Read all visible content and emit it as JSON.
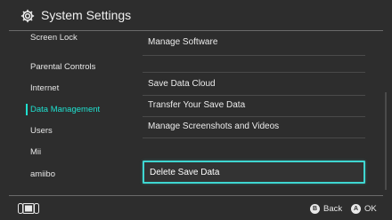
{
  "header": {
    "title": "System Settings",
    "icon": "gear-icon"
  },
  "sidebar": {
    "items": [
      {
        "label": "Screen Lock"
      },
      {
        "label": "Parental Controls"
      },
      {
        "label": "Internet"
      },
      {
        "label": "Data Management",
        "active": true
      },
      {
        "label": "Users"
      },
      {
        "label": "Mii"
      },
      {
        "label": "amiibo"
      }
    ]
  },
  "main": {
    "items": [
      {
        "label": "Manage Software"
      },
      {
        "label": "Save Data Cloud"
      },
      {
        "label": "Transfer Your Save Data"
      },
      {
        "label": "Manage Screenshots and Videos"
      },
      {
        "label": "Delete Save Data",
        "selected": true
      }
    ]
  },
  "footer": {
    "console_icon": "console-icon",
    "hints": [
      {
        "button": "B",
        "label": "Back"
      },
      {
        "button": "A",
        "label": "OK"
      }
    ]
  },
  "colors": {
    "accent": "#1fe0cf",
    "selection_border": "#3fd6d1",
    "background": "#2d2d2d"
  }
}
